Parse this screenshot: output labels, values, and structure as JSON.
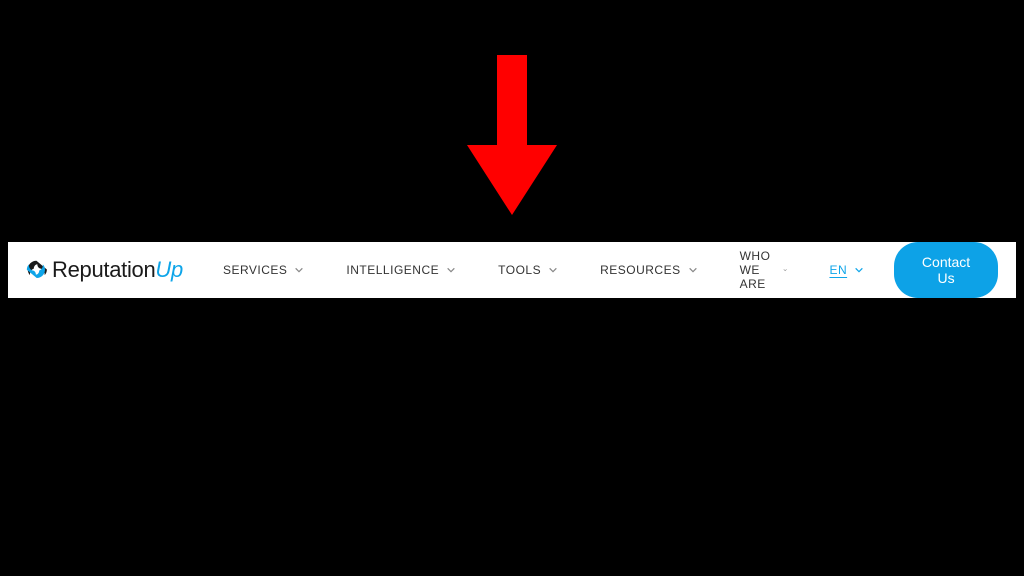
{
  "arrow": {
    "color": "#ff0000"
  },
  "logo": {
    "primary": "Reputation",
    "suffix": "Up"
  },
  "nav": {
    "items": [
      {
        "label": "SERVICES"
      },
      {
        "label": "INTELLIGENCE"
      },
      {
        "label": "TOOLS"
      },
      {
        "label": "RESOURCES"
      },
      {
        "label": "WHO WE ARE"
      }
    ],
    "language": {
      "label": "EN"
    }
  },
  "cta": {
    "label": "Contact Us"
  }
}
